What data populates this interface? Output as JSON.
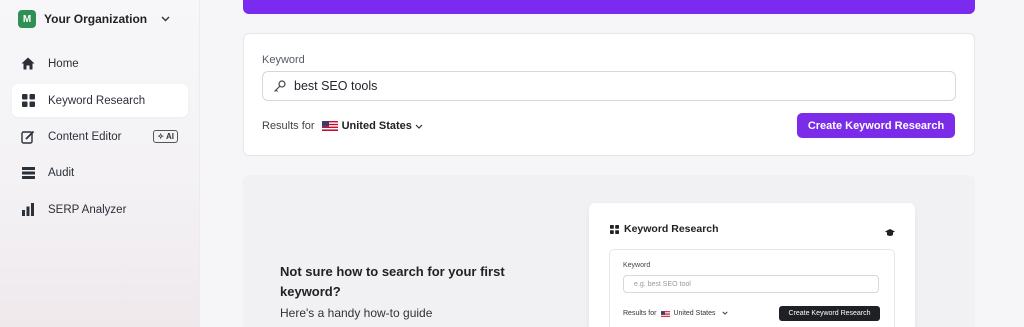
{
  "sidebar": {
    "org": {
      "initial": "M",
      "name": "Your Organization",
      "chevron_icon": "chevron-down-icon"
    },
    "items": [
      {
        "label": "Home",
        "icon": "home-icon"
      },
      {
        "label": "Keyword Research",
        "icon": "grid-icon",
        "active": true
      },
      {
        "label": "Content Editor",
        "icon": "edit-icon",
        "badge": "AI"
      },
      {
        "label": "Audit",
        "icon": "list-icon"
      },
      {
        "label": "SERP Analyzer",
        "icon": "bar-chart-icon"
      }
    ]
  },
  "search": {
    "keyword_label": "Keyword",
    "keyword_value": "best SEO tools",
    "results_for_label": "Results for",
    "country": "United States",
    "create_button": "Create Keyword Research"
  },
  "guide": {
    "title": "Not sure how to search for your first keyword?",
    "subtitle": "Here's a handy how-to guide",
    "preview": {
      "header": "Keyword Research",
      "keyword_label": "Keyword",
      "placeholder": "e.g. best SEO tool",
      "results_for_label": "Results for",
      "country": "United States",
      "create_button": "Create Keyword Research"
    }
  },
  "colors": {
    "accent": "#7a2ce8",
    "banner": "#7b2bf0",
    "org_avatar": "#2f8f55"
  }
}
